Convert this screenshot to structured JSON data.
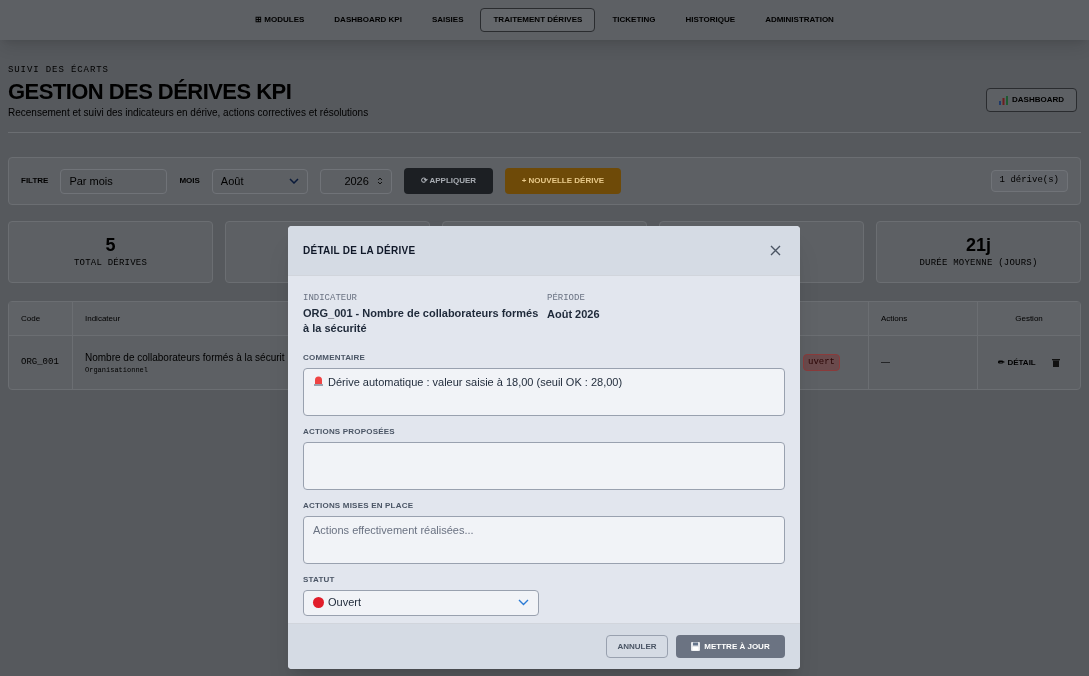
{
  "nav": [
    {
      "label": "⊞ MODULES",
      "selected": false
    },
    {
      "label": "DASHBOARD KPI",
      "selected": false
    },
    {
      "label": "SAISIES",
      "selected": false
    },
    {
      "label": "TRAITEMENT DÉRIVES",
      "selected": true
    },
    {
      "label": "TICKETING",
      "selected": false
    },
    {
      "label": "HISTORIQUE",
      "selected": false
    },
    {
      "label": "ADMINISTRATION",
      "selected": false
    }
  ],
  "header": {
    "eyebrow": "SUIVI DES ÉCARTS",
    "title": "GESTION DES DÉRIVES KPI",
    "subtitle": "Recensement et suivi des indicateurs en dérive, actions correctives et résolutions",
    "button": "DASHBOARD"
  },
  "filters": {
    "filter_label": "FILTRE",
    "filter_value": "Par mois",
    "month_label": "MOIS",
    "month_value": "Août",
    "year_value": "2026",
    "apply": "⟳ APPLIQUER",
    "new": "+ NOUVELLE DÉRIVE",
    "count": "1 dérive(s)"
  },
  "stats": [
    {
      "value": "5",
      "label": "TOTAL DÉRIVES"
    },
    {
      "value": "21j",
      "label": "DURÉE MOYENNE (JOURS)"
    }
  ],
  "table": {
    "columns": [
      "Code",
      "Indicateur",
      "Actions",
      "Gestion"
    ],
    "rows": [
      {
        "code": "ORG_001",
        "indicator": "Nombre de collaborateurs formés à la sécurit",
        "category": "Organisationnel",
        "status": "uvert",
        "actions": "—",
        "detail": "✏ DÉTAIL"
      }
    ]
  },
  "modal": {
    "title": "DÉTAIL DE LA DÉRIVE",
    "indicator_label": "INDICATEUR",
    "indicator": "ORG_001 - Nombre de collaborateurs formés à la sécurité",
    "period_label": "PÉRIODE",
    "period": "Août 2026",
    "fields": [
      {
        "label": "COMMENTAIRE",
        "value": "Dérive automatique : valeur saisie à 18,00 (seuil OK : 28,00)",
        "alert": true
      },
      {
        "label": "ACTIONS PROPOSÉES",
        "alert": false
      },
      {
        "label": "ACTIONS MISES EN PLACE",
        "placeholder": "Actions effectivement réalisées...",
        "alert": false
      }
    ],
    "status_label": "STATUT",
    "status": {
      "text": "Ouvert",
      "color": "#e11d2a"
    },
    "cancel": "ANNULER",
    "submit": "METTRE À JOUR"
  }
}
